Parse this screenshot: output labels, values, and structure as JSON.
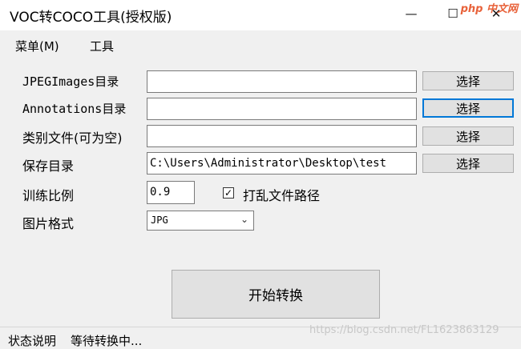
{
  "window": {
    "title": "VOC转COCO工具(授权版)",
    "minimize_glyph": "—",
    "maximize_glyph": "☐",
    "close_glyph": "✕",
    "watermark": "php 中文网"
  },
  "menu": {
    "items": [
      {
        "label": "菜单(M)"
      },
      {
        "label": "工具"
      }
    ]
  },
  "form": {
    "rows": [
      {
        "label": "JPEGImages目录",
        "value": "",
        "button": "选择"
      },
      {
        "label": "Annotations目录",
        "value": "",
        "button": "选择"
      },
      {
        "label": "类别文件(可为空)",
        "value": "",
        "button": "选择"
      },
      {
        "label": "保存目录",
        "value": "C:\\Users\\Administrator\\Desktop\\test",
        "button": "选择"
      }
    ],
    "train_ratio": {
      "label": "训练比例",
      "value": "0.9"
    },
    "shuffle": {
      "label": "打乱文件路径",
      "checked": true,
      "check_glyph": "✓"
    },
    "image_format": {
      "label": "图片格式",
      "value": "JPG",
      "arrow": "⌄"
    }
  },
  "start_button": "开始转换",
  "status": {
    "label": "状态说明",
    "text": "等待转换中..."
  },
  "credit": "https://blog.csdn.net/FL1623863129",
  "colors": {
    "focus_border": "#0078d7",
    "background": "#f0f0f0",
    "button": "#e1e1e1"
  }
}
